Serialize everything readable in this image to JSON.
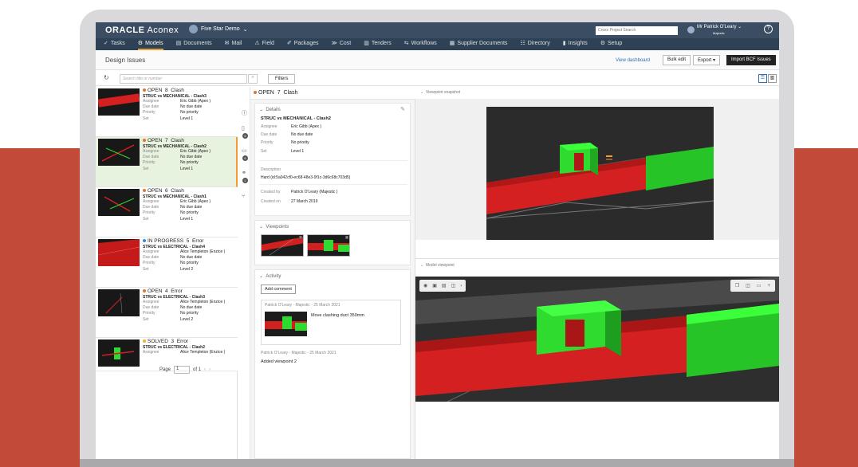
{
  "app": {
    "brand": "ORACLE",
    "product": "Aconex",
    "project": "Five Star Demo",
    "search_placeholder": "Cross Project Search",
    "user_name": "Mr Patrick O'Leary",
    "user_org": "Majestic",
    "help": "?"
  },
  "nav": [
    {
      "icon": "check-icon",
      "glyph": "✓",
      "label": "Tasks"
    },
    {
      "icon": "models-icon",
      "glyph": "⚙",
      "label": "Models"
    },
    {
      "icon": "documents-icon",
      "glyph": "▤",
      "label": "Documents"
    },
    {
      "icon": "mail-icon",
      "glyph": "✉",
      "label": "Mail"
    },
    {
      "icon": "field-icon",
      "glyph": "⚠",
      "label": "Field"
    },
    {
      "icon": "packages-icon",
      "glyph": "✐",
      "label": "Packages"
    },
    {
      "icon": "cost-icon",
      "glyph": "≫",
      "label": "Cost"
    },
    {
      "icon": "tenders-icon",
      "glyph": "▥",
      "label": "Tenders"
    },
    {
      "icon": "workflows-icon",
      "glyph": "⇆",
      "label": "Workflows"
    },
    {
      "icon": "supplier-icon",
      "glyph": "▦",
      "label": "Supplier Documents"
    },
    {
      "icon": "directory-icon",
      "glyph": "☷",
      "label": "Directory"
    },
    {
      "icon": "insights-icon",
      "glyph": "▮",
      "label": "Insights"
    },
    {
      "icon": "setup-icon",
      "glyph": "⚙",
      "label": "Setup"
    }
  ],
  "page": {
    "title": "Design Issues",
    "view_dashboard": "View dashboard",
    "bulk_edit": "Bulk edit",
    "export": "Export ▾",
    "import_bcf": "Import BCF Issues",
    "search_placeholder": "Search title or number",
    "filters": "Filters"
  },
  "issues": [
    {
      "status": "OPEN",
      "number": "8",
      "type": "Clash",
      "title": "STRUC vs MECHANICAL - Clash3",
      "assignee": "Eric Gibb (Apex )",
      "due": "No due date",
      "priority": "No priority",
      "set": "Level 1",
      "dot": "#e8722c"
    },
    {
      "status": "OPEN",
      "number": "7",
      "type": "Clash",
      "title": "STRUC vs MECHANICAL - Clash2",
      "assignee": "Eric Gibb (Apex )",
      "due": "No due date",
      "priority": "No priority",
      "set": "Level 1",
      "dot": "#e8722c"
    },
    {
      "status": "OPEN",
      "number": "6",
      "type": "Clash",
      "title": "STRUC vs MECHANICAL - Clash1",
      "assignee": "Eric Gibb (Apex )",
      "due": "No due date",
      "priority": "No priority",
      "set": "Level 1",
      "dot": "#e8722c"
    },
    {
      "status": "IN PROGRESS",
      "number": "5",
      "type": "Error",
      "title": "STRUC vs ELECTRICAL - Clash4",
      "assignee": "Alice Templeton (Enzice )",
      "due": "No due date",
      "priority": "No priority",
      "set": "Level 2",
      "dot": "#3a86d6"
    },
    {
      "status": "OPEN",
      "number": "4",
      "type": "Error",
      "title": "STRUC vs ELECTRICAL - Clash3",
      "assignee": "Alice Templeton (Enzice )",
      "due": "No due date",
      "priority": "No priority",
      "set": "Level 2",
      "dot": "#e8722c"
    },
    {
      "status": "SOLVED",
      "number": "3",
      "type": "Error",
      "title": "STRUC vs ELECTRICAL - Clash2",
      "assignee": "Alice Templeton (Enzice )",
      "due": "",
      "priority": "",
      "set": "",
      "dot": "#e8b92c"
    }
  ],
  "labels": {
    "assignee": "Assignee",
    "due": "Due date",
    "priority": "Priority",
    "set": "Set"
  },
  "pager": {
    "page_label": "Page",
    "page": "1",
    "of": "of 1",
    "prev": "‹",
    "next": "›"
  },
  "iconbar": {
    "b1": "5",
    "b2": "6",
    "b3": "2"
  },
  "detail": {
    "header_status": "OPEN",
    "header_number": "7",
    "header_type": "Clash",
    "details_label": "Details",
    "title": "STRUC vs MECHANICAL - Clash2",
    "assignee": "Eric Gibb (Apex )",
    "due": "No due date",
    "priority": "No priority",
    "set": "Level 1",
    "description_label": "Description",
    "description": "Hard (id:5a042cf0-ec68-48e3-9f1c-3d6c68c703d5)",
    "created_by_label": "Created by",
    "created_by": "Patrick O'Leary (Majestic )",
    "created_on_label": "Created on",
    "created_on": "27 March 2019",
    "viewpoints_label": "Viewpoints",
    "vp1": "1",
    "vp2": "2",
    "activity_label": "Activity",
    "add_comment": "Add comment",
    "act1_meta": "Patrick O'Leary - Majestic - 25 March 2021",
    "act1_text": "Move clashing duct 350mm",
    "act2_meta": "Patrick O'Leary - Majestic - 25 March 2021",
    "act2_text": "Added viewpoint 2"
  },
  "right": {
    "snapshot_label": "Viewpoint snapshot",
    "model_label": "Model viewpoint"
  },
  "colors": {
    "accent": "#f39a33",
    "header": "#3b4d63",
    "nav": "#2f4154",
    "red": "#e02020",
    "green": "#2edb2e"
  }
}
